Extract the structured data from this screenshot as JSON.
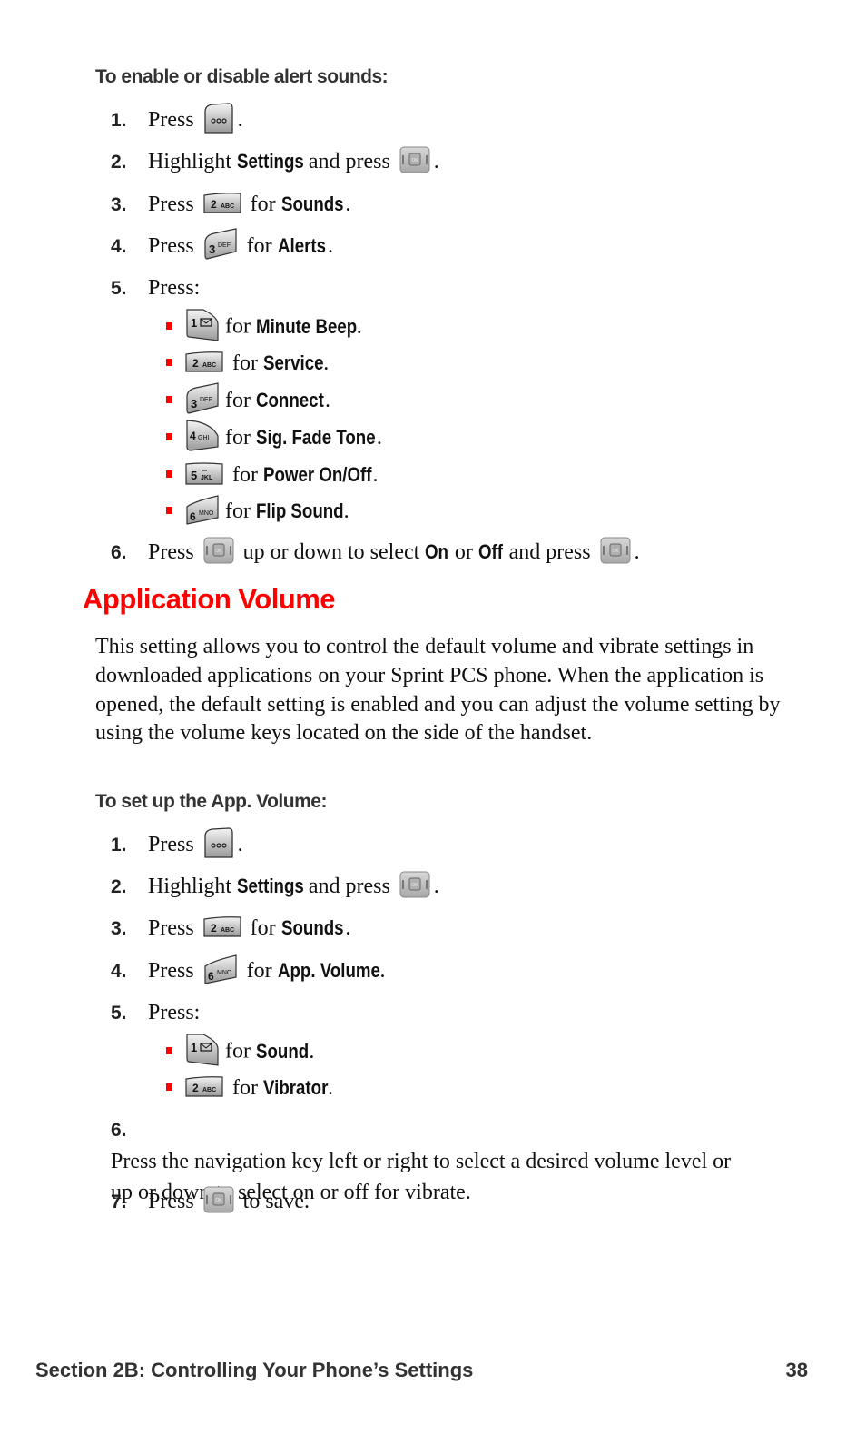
{
  "section1": {
    "subheading": "To enable or disable alert sounds:",
    "steps": [
      {
        "num": "1.",
        "pre": "Press",
        "key": "menu-key",
        "post": "."
      },
      {
        "num": "2.",
        "pre": "Highlight",
        "bold": "Settings",
        "mid": "and press",
        "key": "ok-key",
        "post": "."
      },
      {
        "num": "3.",
        "pre": "Press",
        "key": "2ABC",
        "mid": "for",
        "bold": "Sounds",
        "post": "."
      },
      {
        "num": "4.",
        "pre": "Press",
        "key": "3DEF",
        "mid": "for",
        "bold": "Alerts",
        "post": "."
      },
      {
        "num": "5.",
        "pre": "Press:"
      },
      {
        "num": "6.",
        "pre": "Press",
        "mid": "up or down to select",
        "bold1": "On",
        "or": "or",
        "bold2": "Off",
        "mid2": "and press",
        "post": "."
      }
    ],
    "options": [
      {
        "key": "1",
        "key_sub": "voicemail",
        "for": "for",
        "label": "Minute Beep",
        "post": "."
      },
      {
        "key": "2",
        "key_sub": "ABC",
        "for": "for",
        "label": "Service",
        "post": "."
      },
      {
        "key": "3",
        "key_sub": "DEF",
        "for": "for",
        "label": "Connect",
        "post": "."
      },
      {
        "key": "4",
        "key_sub": "GHI",
        "for": "for",
        "label": "Sig. Fade Tone",
        "post": "."
      },
      {
        "key": "5",
        "key_sub": "JKL",
        "for": "for",
        "label": "Power On/Off",
        "post": "."
      },
      {
        "key": "6",
        "key_sub": "MNO",
        "for": "for",
        "label": "Flip Sound",
        "post": "."
      }
    ]
  },
  "section2": {
    "title": "Application Volume",
    "title_color": "#ff0000",
    "body": "This setting allows you to control the default volume and vibrate settings in downloaded applications on your Sprint PCS phone. When the application is opened, the default setting is enabled and you can adjust the volume setting by using the volume keys located on the side of the handset.",
    "subheading": "To set up the App. Volume:",
    "steps": [
      {
        "num": "1.",
        "pre": "Press",
        "post": "."
      },
      {
        "num": "2.",
        "pre": "Highlight",
        "bold": "Settings",
        "mid": "and press",
        "post": "."
      },
      {
        "num": "3.",
        "pre": "Press",
        "mid": "for",
        "bold": "Sounds",
        "post": "."
      },
      {
        "num": "4.",
        "pre": "Press",
        "mid": "for",
        "bold": "App. Volume",
        "post": "."
      },
      {
        "num": "5.",
        "pre": "Press:"
      },
      {
        "num": "6.",
        "text": "Press the navigation key left or right to select a desired volume level or up or down to select on or off for vibrate."
      },
      {
        "num": "7.",
        "pre": "Press",
        "post": "to save."
      }
    ],
    "options": [
      {
        "key": "1",
        "for": "for",
        "label": "Sound",
        "post": "."
      },
      {
        "key": "2",
        "key_sub": "ABC",
        "for": "for",
        "label": "Vibrator",
        "post": "."
      }
    ]
  },
  "keys": {
    "ok": "OK",
    "k1": "1",
    "k2": "2",
    "k3": "3",
    "k4": "4",
    "k5": "5",
    "k6": "6",
    "abc": "ABC",
    "def": "DEF",
    "ghi": "GHI",
    "jkl": "JKL",
    "mno": "MNO"
  },
  "footer": {
    "section": "Section 2B: Controlling Your Phone’s Settings",
    "page": "38"
  }
}
